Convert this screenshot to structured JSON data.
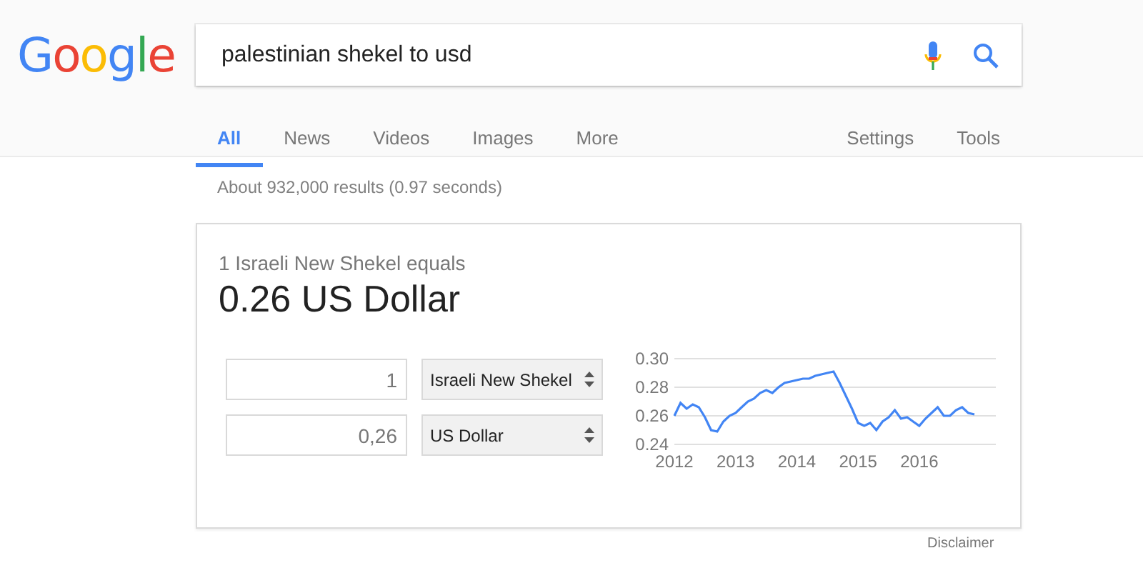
{
  "logo": "Google",
  "search": {
    "value": "palestinian shekel to usd"
  },
  "tabs": [
    {
      "label": "All",
      "selected": true
    },
    {
      "label": "News",
      "selected": false
    },
    {
      "label": "Videos",
      "selected": false
    },
    {
      "label": "Images",
      "selected": false
    },
    {
      "label": "More",
      "selected": false
    }
  ],
  "tools": [
    "Settings",
    "Tools"
  ],
  "result_stats": "About 932,000 results (0.97 seconds)",
  "converter": {
    "subtitle": "1 Israeli New Shekel equals",
    "result": "0.26 US Dollar",
    "rows": [
      {
        "amount": "1",
        "currency": "Israeli New Shekel"
      },
      {
        "amount": "0,26",
        "currency": "US Dollar"
      }
    ],
    "chart_data": {
      "type": "line",
      "x": [
        2012.0,
        2012.1,
        2012.2,
        2012.3,
        2012.4,
        2012.5,
        2012.6,
        2012.7,
        2012.8,
        2012.9,
        2013.0,
        2013.1,
        2013.2,
        2013.3,
        2013.4,
        2013.5,
        2013.6,
        2013.7,
        2013.8,
        2013.9,
        2014.0,
        2014.1,
        2014.2,
        2014.3,
        2014.4,
        2014.5,
        2014.6,
        2014.7,
        2014.8,
        2014.9,
        2015.0,
        2015.1,
        2015.2,
        2015.3,
        2015.4,
        2015.5,
        2015.6,
        2015.7,
        2015.8,
        2015.9,
        2016.0,
        2016.1,
        2016.2,
        2016.3,
        2016.4,
        2016.5,
        2016.6,
        2016.7,
        2016.8,
        2016.9
      ],
      "series": [
        {
          "color": "#4285f4",
          "values": [
            0.26,
            0.269,
            0.265,
            0.268,
            0.266,
            0.259,
            0.25,
            0.249,
            0.256,
            0.26,
            0.262,
            0.266,
            0.27,
            0.272,
            0.276,
            0.278,
            0.276,
            0.28,
            0.283,
            0.284,
            0.285,
            0.286,
            0.286,
            0.288,
            0.289,
            0.29,
            0.291,
            0.283,
            0.274,
            0.265,
            0.255,
            0.253,
            0.255,
            0.25,
            0.256,
            0.259,
            0.264,
            0.258,
            0.259,
            0.256,
            0.253,
            0.258,
            0.262,
            0.266,
            0.26,
            0.26,
            0.264,
            0.266,
            0.262,
            0.261
          ]
        }
      ],
      "xlim": [
        2012,
        2017.25
      ],
      "ylim": [
        0.24,
        0.3
      ],
      "yticks": [
        {
          "value": 0.24,
          "label": "0.24"
        },
        {
          "value": 0.26,
          "label": "0.26"
        },
        {
          "value": 0.28,
          "label": "0.28"
        },
        {
          "value": 0.3,
          "label": "0.30"
        }
      ],
      "xticks": [
        2012,
        2013,
        2014,
        2015,
        2016
      ]
    }
  },
  "disclaimer": "Disclaimer"
}
